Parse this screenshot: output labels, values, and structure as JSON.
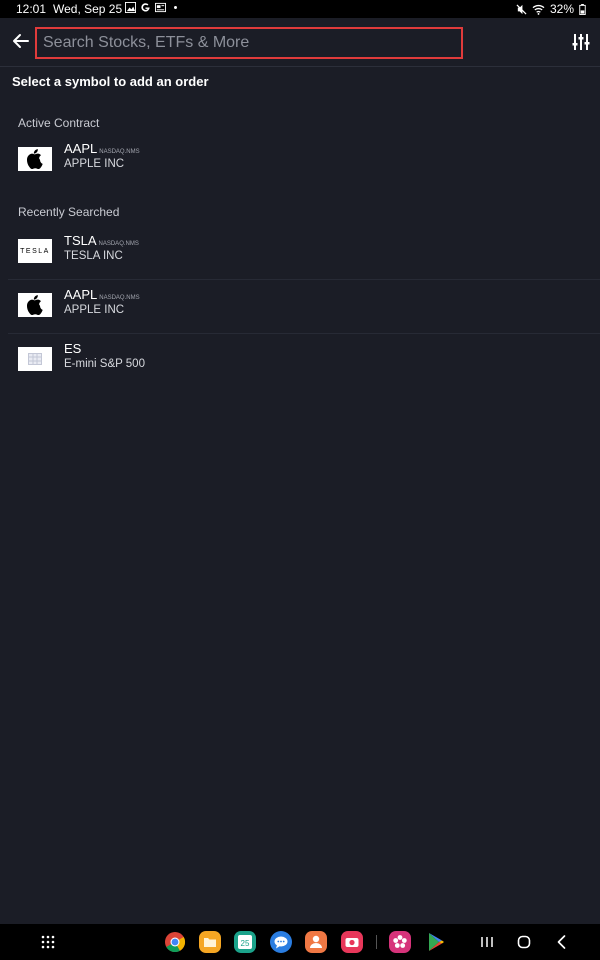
{
  "status_bar": {
    "time": "12:01",
    "date": "Wed, Sep 25",
    "battery": "32%"
  },
  "header": {
    "search_placeholder": "Search Stocks, ETFs & More",
    "accent_border_color": "#e03b3b"
  },
  "prompt": "Select a symbol to add an order",
  "active_contract": {
    "title": "Active Contract",
    "items": [
      {
        "symbol": "AAPL",
        "exchange": "NASDAQ.NMS",
        "name": "APPLE INC",
        "logo": "apple-logo-icon"
      }
    ]
  },
  "recently_searched": {
    "title": "Recently Searched",
    "items": [
      {
        "symbol": "TSLA",
        "exchange": "NASDAQ.NMS",
        "name": "TESLA INC",
        "logo": "tesla-logo-icon",
        "logo_text": "TESLA"
      },
      {
        "symbol": "AAPL",
        "exchange": "NASDAQ.NMS",
        "name": "APPLE INC",
        "logo": "apple-logo-icon"
      },
      {
        "symbol": "ES",
        "exchange": "",
        "name": "E-mini S&P 500",
        "logo": "futures-grid-icon"
      }
    ]
  },
  "navbar": {
    "calendar_badge": "25",
    "apps": [
      "chrome-icon",
      "files-icon",
      "calendar-icon",
      "messages-icon",
      "contacts-icon",
      "camera-app-icon",
      "flower-app-icon",
      "play-store-icon"
    ]
  }
}
